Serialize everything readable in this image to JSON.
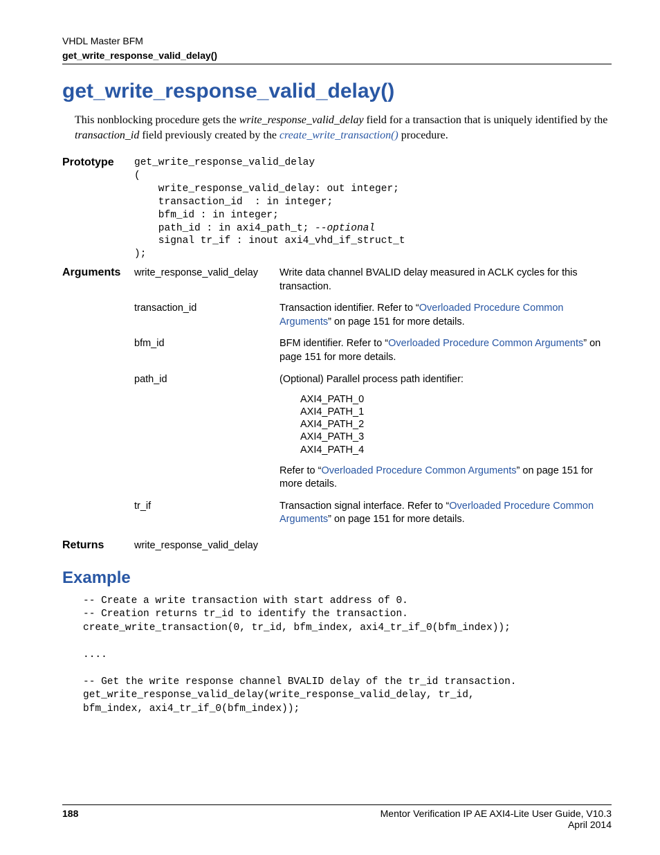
{
  "header": {
    "category": "VHDL Master BFM",
    "topic": "get_write_response_valid_delay()"
  },
  "title": "get_write_response_valid_delay()",
  "intro": {
    "p1a": "This nonblocking procedure gets the ",
    "p1_field1": "write_response_valid_delay",
    "p1b": " field for a transaction that is uniquely identified by the ",
    "p1_field2": "transaction_id",
    "p1c": " field previously created by the ",
    "p1_link": "create_write_transaction()",
    "p1d": " procedure."
  },
  "sections": {
    "prototype_label": "Prototype",
    "arguments_label": "Arguments",
    "returns_label": "Returns",
    "example_label": "Example"
  },
  "prototype": {
    "l1": "get_write_response_valid_delay",
    "l2": "(",
    "l3": "    write_response_valid_delay: out integer;",
    "l4": "    transaction_id  : in integer;",
    "l5": "    bfm_id : in integer;",
    "l6a": "    path_id : in axi4_path_t; ",
    "l6b": "--optional",
    "l7": "    signal tr_if : inout axi4_vhd_if_struct_t",
    "l8": ");"
  },
  "arguments": [
    {
      "name": "write_response_valid_delay",
      "desc_plain": "Write data channel BVALID delay measured in ACLK cycles for this transaction."
    },
    {
      "name": "transaction_id",
      "desc_pre": "Transaction identifier. Refer to “",
      "desc_link": "Overloaded Procedure Common Arguments",
      "desc_post": "” on page 151 for more details."
    },
    {
      "name": "bfm_id",
      "desc_pre": "BFM identifier. Refer to “",
      "desc_link": "Overloaded Procedure Common Arguments",
      "desc_post": "” on page 151 for more details."
    },
    {
      "name": "path_id",
      "desc_plain": "(Optional) Parallel process path identifier:",
      "paths": [
        "AXI4_PATH_0",
        "AXI4_PATH_1",
        "AXI4_PATH_2",
        "AXI4_PATH_3",
        "AXI4_PATH_4"
      ],
      "desc2_pre": "Refer to “",
      "desc2_link": "Overloaded Procedure Common Arguments",
      "desc2_post": "” on page 151 for more details."
    },
    {
      "name": "tr_if",
      "desc_pre": "Transaction signal interface. Refer to “",
      "desc_link": "Overloaded Procedure Common Arguments",
      "desc_post": "” on page 151 for more details."
    }
  ],
  "returns": "write_response_valid_delay",
  "example_code": "-- Create a write transaction with start address of 0.\n-- Creation returns tr_id to identify the transaction.\ncreate_write_transaction(0, tr_id, bfm_index, axi4_tr_if_0(bfm_index));\n\n....\n\n-- Get the write response channel BVALID delay of the tr_id transaction.\nget_write_response_valid_delay(write_response_valid_delay, tr_id,\nbfm_index, axi4_tr_if_0(bfm_index));",
  "footer": {
    "page": "188",
    "booktitle": "Mentor Verification IP AE AXI4-Lite User Guide, V10.3",
    "date": "April 2014"
  }
}
